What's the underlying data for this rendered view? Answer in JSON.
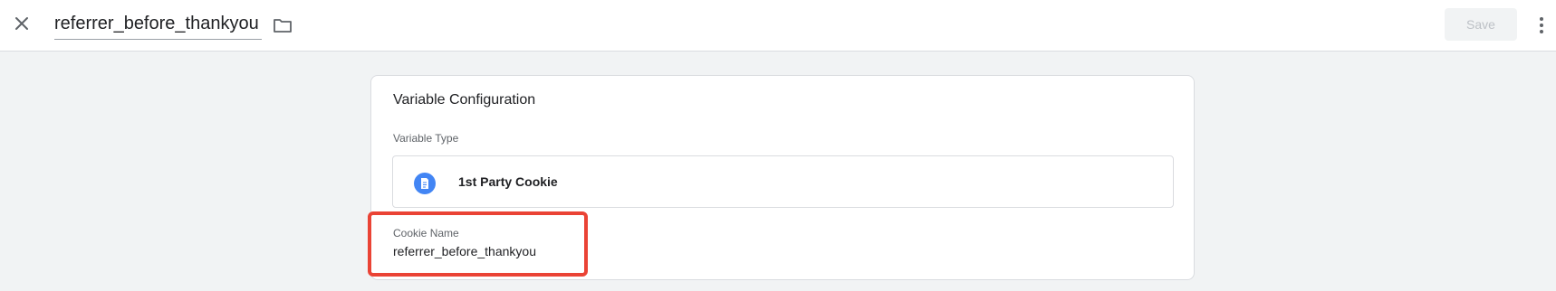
{
  "header": {
    "variable_name": "referrer_before_thankyou",
    "save_label": "Save",
    "close_icon": "close-icon",
    "folder_icon": "folder-icon",
    "more_icon": "more-vert-icon"
  },
  "card": {
    "title": "Variable Configuration",
    "variable_type_label": "Variable Type",
    "variable_type_value": "1st Party Cookie",
    "variable_type_icon": "document-icon",
    "cookie_name_label": "Cookie Name",
    "cookie_name_value": "referrer_before_thankyou"
  },
  "colors": {
    "accent_blue": "#4285f4",
    "highlight_red": "#ea4335",
    "background": "#f1f3f4"
  }
}
